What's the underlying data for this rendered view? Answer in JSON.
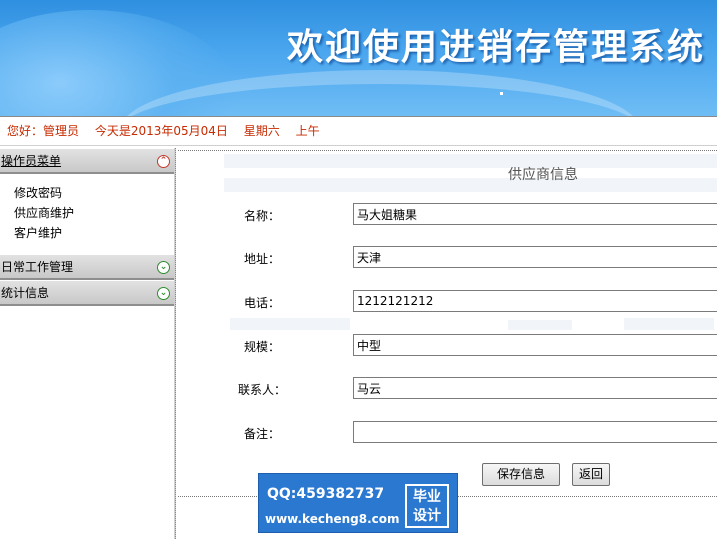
{
  "banner": {
    "title": "欢迎使用进销存管理系统"
  },
  "greeting": {
    "hello": "您好：管理员",
    "date": "今天是2013年05月04日",
    "weekday": "星期六",
    "period": "上午"
  },
  "sidebar": {
    "groups": [
      {
        "label": "操作员菜单",
        "toggle": "up",
        "items": [
          "修改密码",
          "供应商维护",
          "客户维护"
        ]
      },
      {
        "label": "日常工作管理",
        "toggle": "down"
      },
      {
        "label": "统计信息",
        "toggle": "down"
      }
    ]
  },
  "form": {
    "title": "供应商信息",
    "fields": [
      {
        "label": "名称：",
        "value": "马大姐糖果"
      },
      {
        "label": "地址：",
        "value": "天津"
      },
      {
        "label": "电话：",
        "value": "1212121212"
      },
      {
        "label": "规模：",
        "value": "中型"
      },
      {
        "label": "联系人：",
        "value": "马云"
      },
      {
        "label": "备注：",
        "value": ""
      }
    ],
    "save_label": "保存信息",
    "back_label": "返回"
  },
  "watermark": {
    "qq": "QQ:459382737",
    "site": "www.kecheng8.com",
    "badge_line1": "毕业",
    "badge_line2": "设计"
  },
  "colors": {
    "greeting_text": "#c62a00",
    "banner_blue": "#4aa6ee",
    "watermark_bg": "#2b78d0"
  }
}
